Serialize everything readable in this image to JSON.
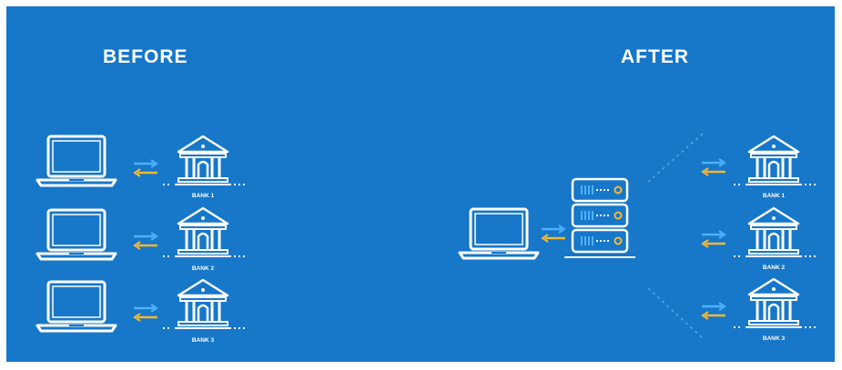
{
  "headings": {
    "before": "BEFORE",
    "after": "AFTER"
  },
  "before_rows": [
    {
      "bank_label": "BANK 1"
    },
    {
      "bank_label": "BANK 2"
    },
    {
      "bank_label": "BANK 3"
    }
  ],
  "after_banks": [
    {
      "bank_label": "BANK 1"
    },
    {
      "bank_label": "BANK 2"
    },
    {
      "bank_label": "BANK 3"
    }
  ],
  "colors": {
    "background": "#1777c9",
    "line": "#ffffff",
    "arrow_right": "#4db3ff",
    "arrow_left": "#f5b82e",
    "server_bars": "#4db3ff",
    "server_dot": "#f5b82e",
    "dashed_line": "#5aa7e6"
  },
  "icons": [
    "laptop-icon",
    "bank-icon",
    "server-stack-icon",
    "arrow-right-icon",
    "arrow-left-icon"
  ]
}
